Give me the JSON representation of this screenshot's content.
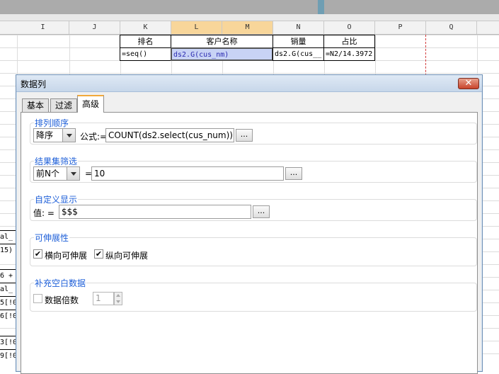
{
  "columns": [
    "I",
    "J",
    "K",
    "L",
    "M",
    "N",
    "O",
    "P",
    "Q"
  ],
  "table": {
    "headers": [
      "排名",
      "客户名称",
      "销量",
      "占比"
    ],
    "cells": [
      "=seq()",
      "ds2.G(cus_nm)",
      "ds2.G(cus__",
      "=N2/14.3972"
    ]
  },
  "left_fragments": [
    "al_",
    "15)",
    "6 +",
    "al_",
    "5[!0",
    "6[!0",
    "3[!0",
    "9[!0"
  ],
  "dialog": {
    "title": "数据列",
    "close_label": "✕",
    "tabs": [
      "基本",
      "过滤",
      "高级"
    ],
    "active_tab": "高级",
    "sort": {
      "group_title": "排列顺序",
      "order": "降序",
      "formula_label": "公式:=",
      "formula": "COUNT(ds2.select(cus_num))"
    },
    "filter": {
      "group_title": "结果集筛选",
      "mode": "前N个",
      "eq_label": "=",
      "value": "10"
    },
    "custom": {
      "group_title": "自定义显示",
      "value_label": "值:  =",
      "value": "$$$"
    },
    "expand": {
      "group_title": "可伸展性",
      "horizontal_label": "横向可伸展",
      "horizontal_checked": true,
      "vertical_label": "纵向可伸展",
      "vertical_checked": true
    },
    "fill": {
      "group_title": "补充空白数据",
      "multiple_label": "数据倍数",
      "multiple_checked": false,
      "multiple_value": "1"
    },
    "dots_label": "..."
  },
  "colors": {
    "accent_tab": "#f2a93b",
    "group_title": "#1e5fd8",
    "selected_cell": "#c8d3f5",
    "selected_column_header": "#f8d69a"
  }
}
